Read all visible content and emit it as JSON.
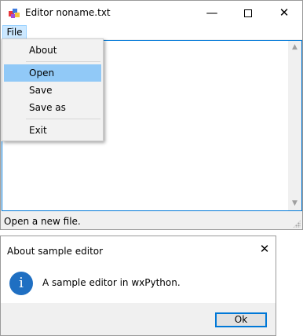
{
  "window": {
    "title": "Editor noname.txt",
    "minimize_glyph": "—",
    "close_glyph": "✕"
  },
  "menubar": {
    "file_label": "File"
  },
  "file_menu": {
    "items": [
      "About",
      "Open",
      "Save",
      "Save as",
      "Exit"
    ],
    "highlighted": "Open"
  },
  "statusbar": {
    "text": "Open a new file."
  },
  "about_dialog": {
    "title": "About sample editor",
    "message": "A sample editor in wxPython.",
    "icon_glyph": "i",
    "ok_label": "Ok",
    "close_glyph": "✕"
  },
  "scrollbar": {
    "up_glyph": "▲",
    "down_glyph": "▼"
  },
  "colors": {
    "accent": "#0078d7",
    "menu_highlight": "#91c9f7",
    "info_icon": "#1f6fc2"
  }
}
